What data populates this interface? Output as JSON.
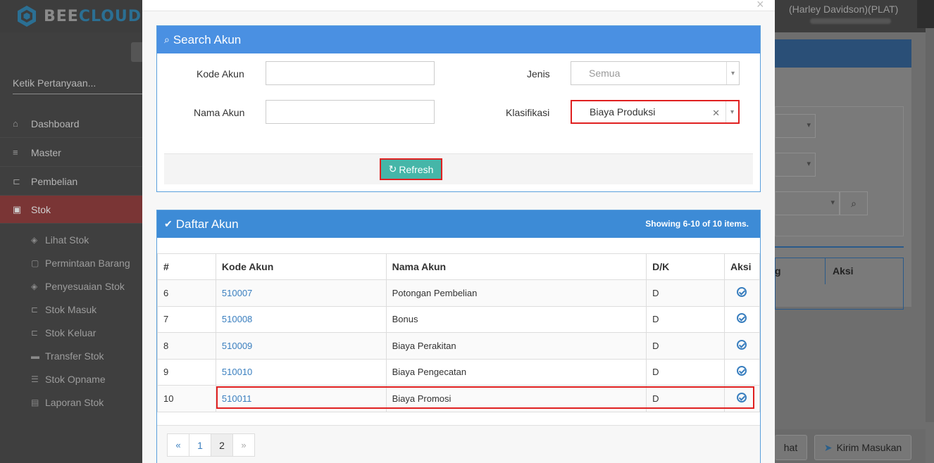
{
  "app": {
    "logo_text_1": "BEE",
    "logo_text_2": "CLOUD",
    "user_name": "(Harley Davidson)(PLAT)"
  },
  "sidebar": {
    "search_placeholder": "Ketik Pertanyaan...",
    "items": [
      {
        "label": "Dashboard",
        "icon": "home-icon"
      },
      {
        "label": "Master",
        "icon": "database-icon"
      },
      {
        "label": "Pembelian",
        "icon": "cart-icon"
      },
      {
        "label": "Stok",
        "icon": "box-icon"
      }
    ],
    "sub_items": [
      {
        "label": "Lihat Stok",
        "icon": "cubes-icon"
      },
      {
        "label": "Permintaan Barang",
        "icon": "file-icon"
      },
      {
        "label": "Penyesuaian Stok",
        "icon": "cubes-icon"
      },
      {
        "label": "Stok Masuk",
        "icon": "cart-in-icon"
      },
      {
        "label": "Stok Keluar",
        "icon": "cart-out-icon"
      },
      {
        "label": "Transfer Stok",
        "icon": "truck-icon"
      },
      {
        "label": "Stok Opname",
        "icon": "list-icon"
      },
      {
        "label": "Laporan Stok",
        "icon": "book-icon"
      }
    ]
  },
  "background": {
    "col_partial": "g",
    "col_aksi": "Aksi",
    "btn_lihat_partial": "hat",
    "btn_kirim": "Kirim Masukan"
  },
  "search_panel": {
    "title": "Search Akun",
    "kode_label": "Kode Akun",
    "kode_value": "",
    "nama_label": "Nama Akun",
    "nama_value": "",
    "jenis_label": "Jenis",
    "jenis_value": "Semua",
    "klasifikasi_label": "Klasifikasi",
    "klasifikasi_value": "Biaya Produksi",
    "refresh_label": "Refresh"
  },
  "list_panel": {
    "title": "Daftar Akun",
    "showing_prefix": "Showing ",
    "showing_range": "6-10",
    "showing_mid": " of ",
    "showing_total": "10",
    "showing_suffix": " items.",
    "columns": [
      "#",
      "Kode Akun",
      "Nama Akun",
      "D/K",
      "Aksi"
    ],
    "rows": [
      {
        "no": "6",
        "kode": "510007",
        "nama": "Potongan Pembelian",
        "dk": "D"
      },
      {
        "no": "7",
        "kode": "510008",
        "nama": "Bonus",
        "dk": "D"
      },
      {
        "no": "8",
        "kode": "510009",
        "nama": "Biaya Perakitan",
        "dk": "D"
      },
      {
        "no": "9",
        "kode": "510010",
        "nama": "Biaya Pengecatan",
        "dk": "D"
      },
      {
        "no": "10",
        "kode": "510011",
        "nama": "Biaya Promosi",
        "dk": "D"
      }
    ],
    "pager": {
      "prev": "«",
      "pages": [
        "1",
        "2"
      ],
      "current": "2",
      "next": "»"
    }
  }
}
